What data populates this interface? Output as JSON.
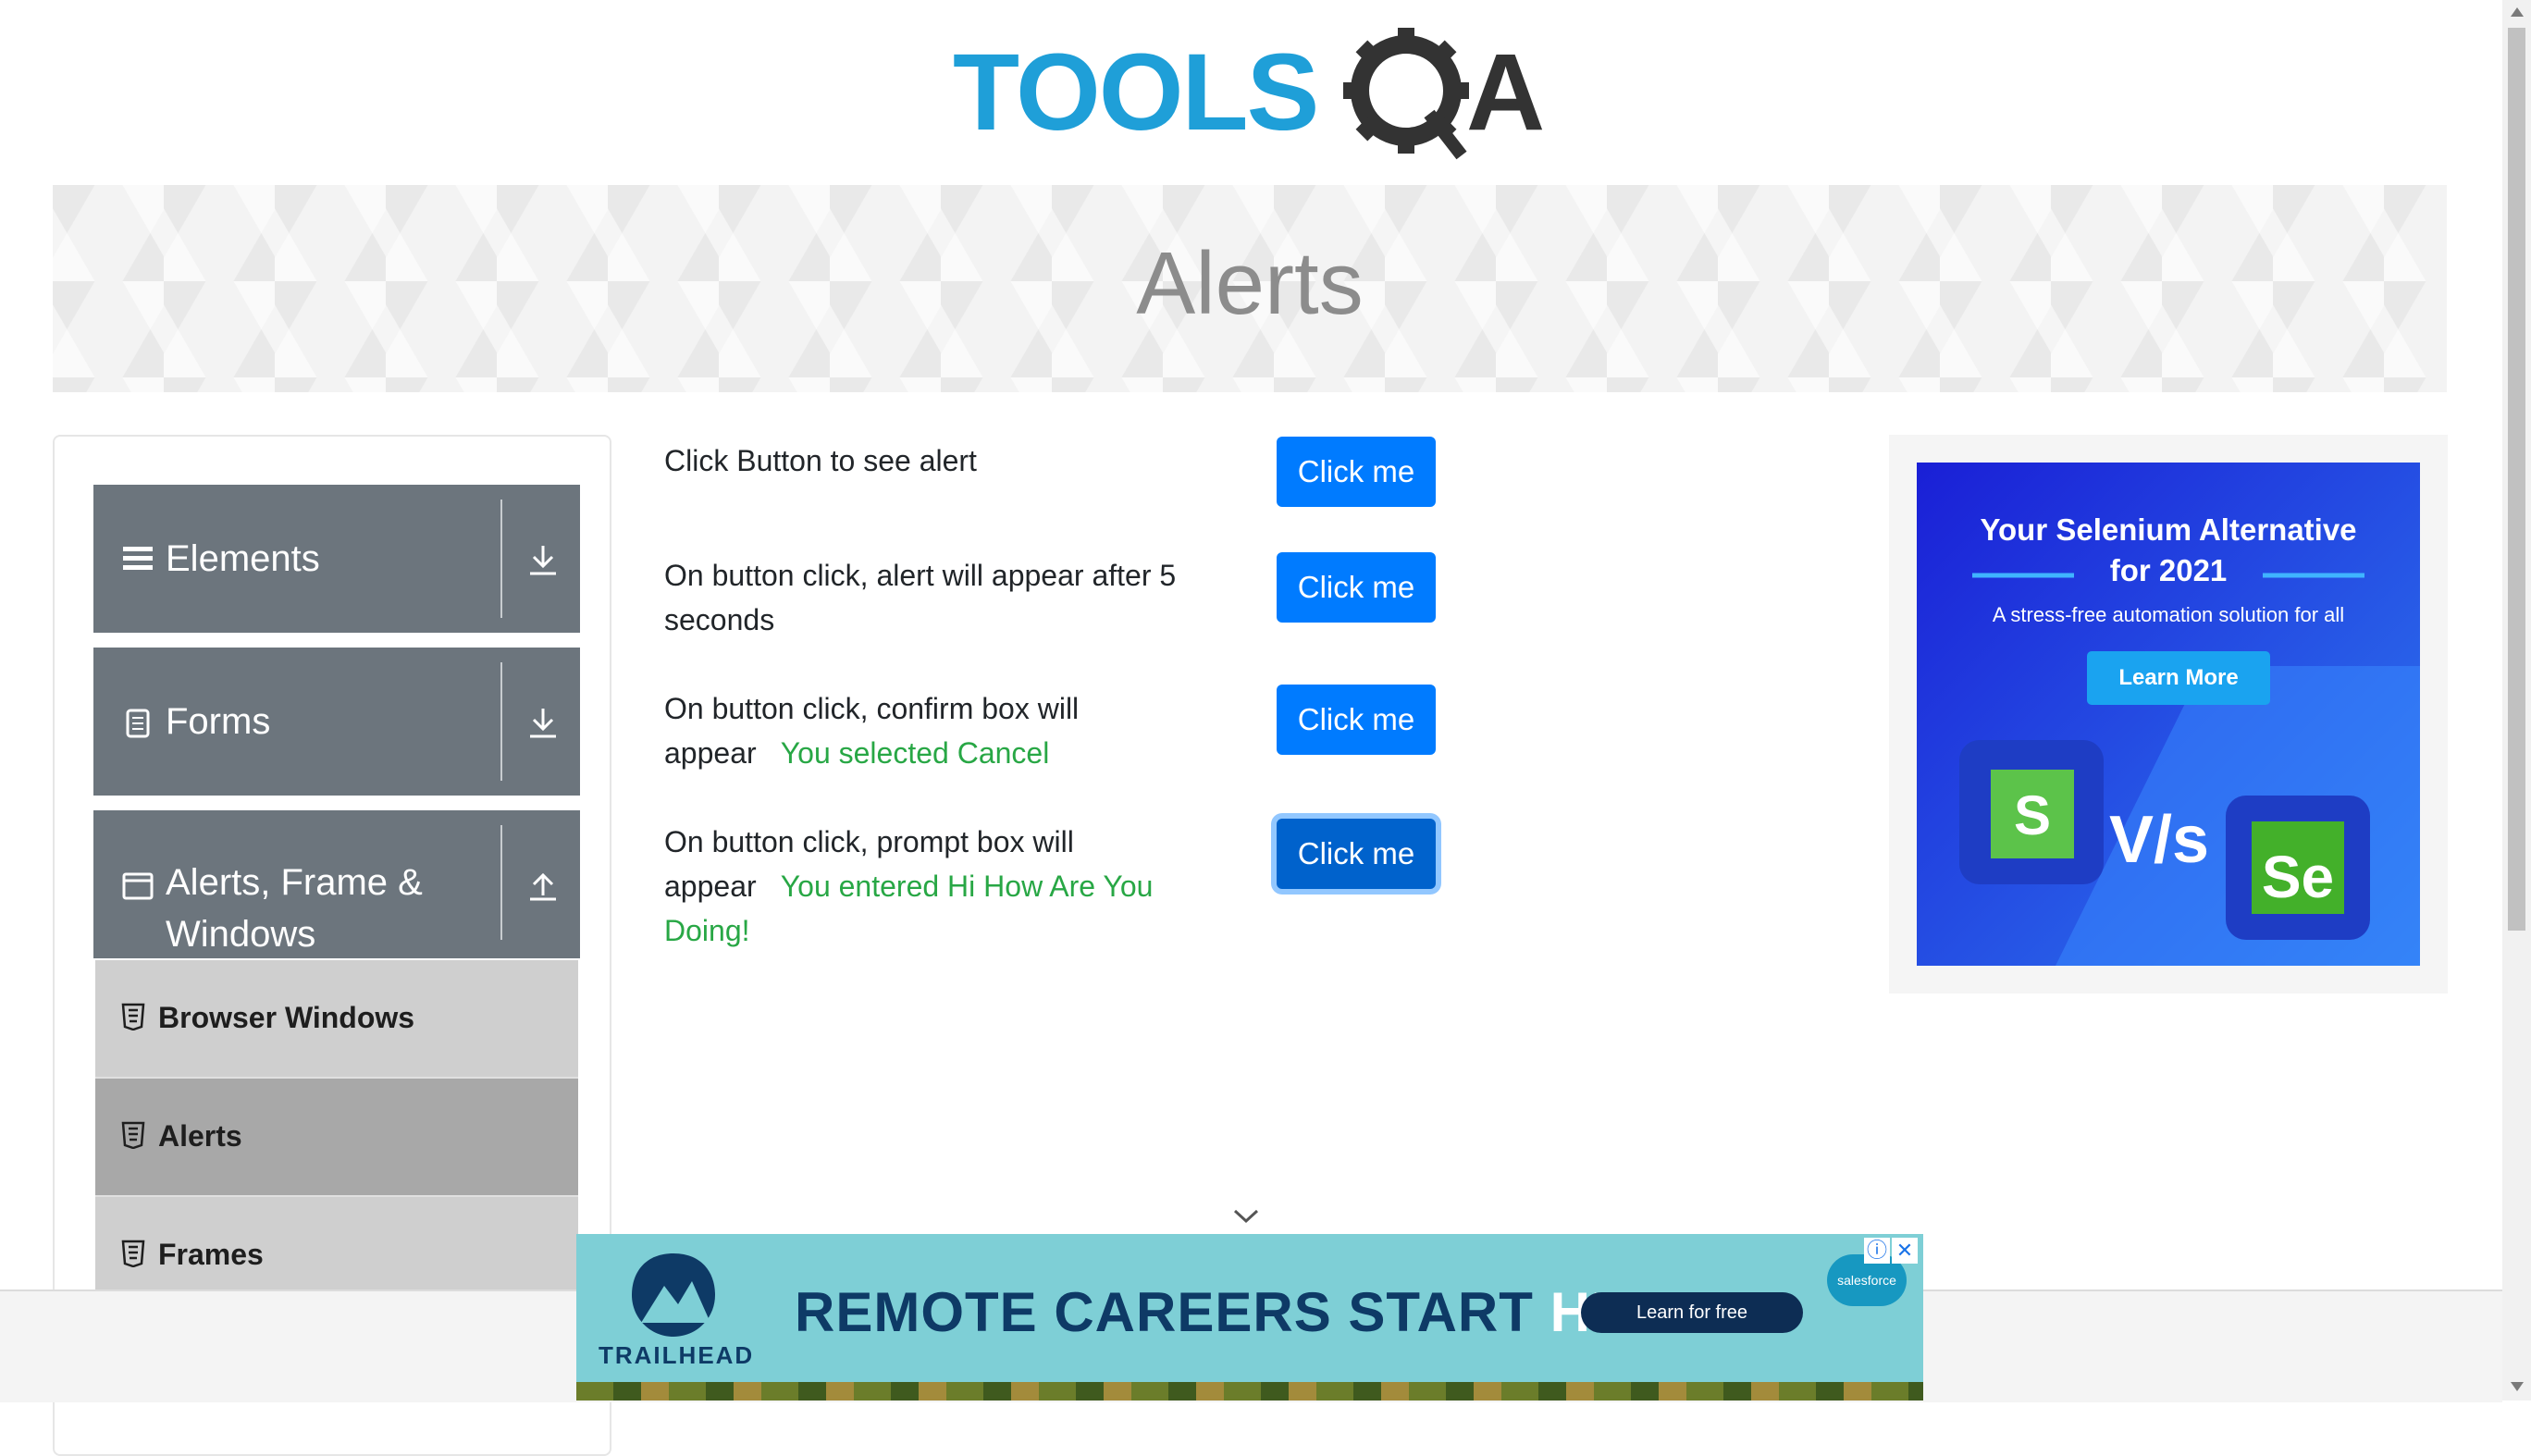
{
  "logo": {
    "text_main": "TOOLS",
    "text_qa": "QA"
  },
  "page_title": "Alerts",
  "sidebar": {
    "groups": [
      {
        "label": "Elements",
        "icon": "hamburger-icon",
        "arrow": "download-arrow-icon"
      },
      {
        "label": "Forms",
        "icon": "document-icon",
        "arrow": "download-arrow-icon"
      },
      {
        "label_line1": "Alerts, Frame &",
        "label_line2": "Windows",
        "icon": "window-icon",
        "arrow": "upload-arrow-icon"
      }
    ],
    "items": [
      {
        "label": "Browser Windows",
        "active": false
      },
      {
        "label": "Alerts",
        "active": true
      },
      {
        "label": "Frames",
        "active": false
      }
    ]
  },
  "alerts": [
    {
      "text": "Click Button to see alert",
      "button": "Click me",
      "result": ""
    },
    {
      "text": "On button click, alert will appear after 5 seconds",
      "button": "Click me",
      "result": ""
    },
    {
      "text": "On button click, confirm box will appear",
      "button": "Click me",
      "result": "You selected Cancel"
    },
    {
      "text": "On button click, prompt box will appear",
      "button": "Click me",
      "result": "You entered Hi How Are You Doing!"
    }
  ],
  "ad_right": {
    "headline_line1": "Your Selenium Alternative",
    "headline_line2": "for 2021",
    "subtitle": "A stress-free automation solution for all",
    "cta": "Learn More",
    "vs": "V/s",
    "se_label": "Se",
    "s_label": "S"
  },
  "ad_bottom": {
    "headline": "REMOTE CAREERS START ",
    "headline_highlight": "HERE.",
    "cta": "Learn for free",
    "brand": "TRAILHEAD",
    "sponsor": "salesforce",
    "info_icon": "ⓘ",
    "close_icon": "✕"
  },
  "colors": {
    "primary_button": "#007bff",
    "sidebar_group": "#6c757d",
    "result_green": "#28a745",
    "logo_blue": "#1f9fd8"
  }
}
